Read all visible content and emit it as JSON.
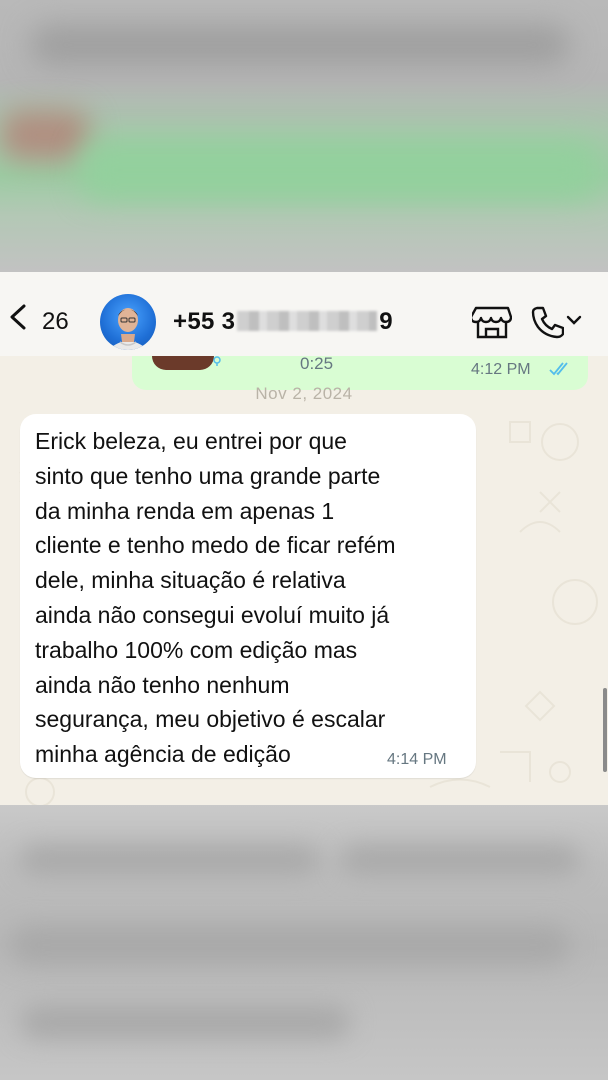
{
  "header": {
    "back_count": "26",
    "contact_prefix": "+55 3",
    "contact_suffix": "9",
    "icons": [
      "chevron-left-icon",
      "avatar",
      "store-icon",
      "phone-icon",
      "chevron-down-icon"
    ]
  },
  "audio_message": {
    "duration": "0:25",
    "time": "4:12 PM",
    "status": "read"
  },
  "date_separator": "Nov 2, 2024",
  "incoming_message": {
    "text": "Erick beleza, eu entrei por que\nsinto que tenho uma grande parte\nda minha renda em apenas 1\ncliente e tenho medo de ficar refém\ndele, minha situação é relativa\nainda não consegui evoluí muito já\ntrabalho 100% com edição mas\nainda não tenho nenhum\nsegurança, meu objetivo é escalar\nminha agência de edição",
    "time": "4:14 PM"
  },
  "colors": {
    "incoming_bubble": "#ffffff",
    "outgoing_bubble": "#d9fdd3",
    "chat_background": "#f3efe6",
    "read_ticks": "#53bdeb"
  }
}
